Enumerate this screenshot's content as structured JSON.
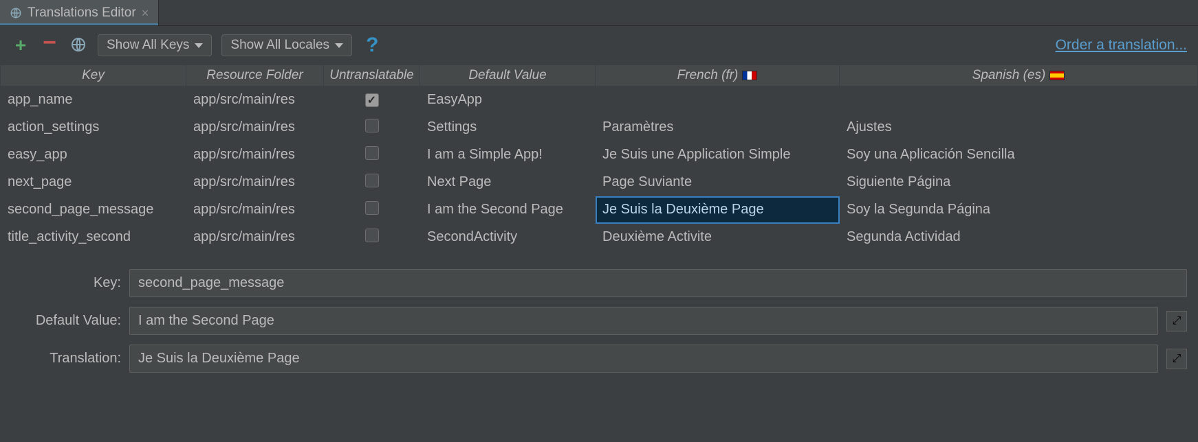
{
  "tab": {
    "title": "Translations Editor"
  },
  "toolbar": {
    "keys_filter": "Show All Keys",
    "locales_filter": "Show All Locales",
    "order_link": "Order a translation..."
  },
  "columns": {
    "key": "Key",
    "resource_folder": "Resource Folder",
    "untranslatable": "Untranslatable",
    "default_value": "Default Value",
    "french": "French (fr)",
    "spanish": "Spanish (es)"
  },
  "rows": [
    {
      "key": "app_name",
      "folder": "app/src/main/res",
      "untranslatable": true,
      "default": "EasyApp",
      "fr": "",
      "es": ""
    },
    {
      "key": "action_settings",
      "folder": "app/src/main/res",
      "untranslatable": false,
      "default": "Settings",
      "fr": "Paramètres",
      "es": "Ajustes"
    },
    {
      "key": "easy_app",
      "folder": "app/src/main/res",
      "untranslatable": false,
      "default": "I am a Simple App!",
      "fr": "Je Suis une Application Simple",
      "es": "Soy una Aplicación Sencilla"
    },
    {
      "key": "next_page",
      "folder": "app/src/main/res",
      "untranslatable": false,
      "default": "Next Page",
      "fr": "Page Suviante",
      "es": "Siguiente Página"
    },
    {
      "key": "second_page_message",
      "folder": "app/src/main/res",
      "untranslatable": false,
      "default": "I am the Second Page",
      "fr": "Je Suis la Deuxième Page",
      "es": "Soy la Segunda Página"
    },
    {
      "key": "title_activity_second",
      "folder": "app/src/main/res",
      "untranslatable": false,
      "default": "SecondActivity",
      "fr": "Deuxième Activite",
      "es": "Segunda Actividad"
    }
  ],
  "selection": {
    "row": 4,
    "col": "fr"
  },
  "detail": {
    "key_label": "Key:",
    "default_label": "Default Value:",
    "translation_label": "Translation:",
    "key": "second_page_message",
    "default": "I am the Second Page",
    "translation": "Je Suis la Deuxième Page"
  }
}
